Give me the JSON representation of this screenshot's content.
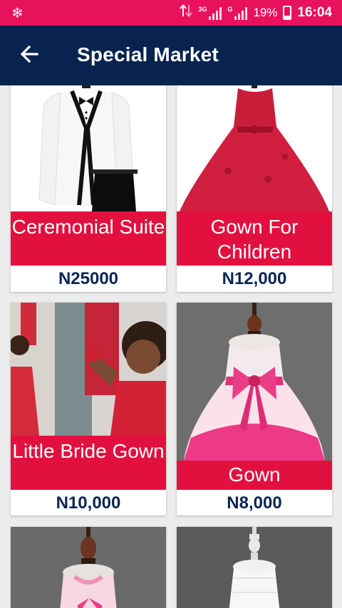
{
  "status_bar": {
    "network_1": "3G",
    "network_2": "G",
    "battery": "19%",
    "time": "16:04"
  },
  "app_bar": {
    "title": "Special Market"
  },
  "products": [
    {
      "name": "Ceremonial Suite",
      "price": "N25000"
    },
    {
      "name": "Gown For Children",
      "price": "N12,000"
    },
    {
      "name": "Little Bride Gown",
      "price": "N10,000"
    },
    {
      "name": "Gown",
      "price": "N8,000"
    }
  ],
  "colors": {
    "status_bar": "#e8115c",
    "app_bar": "#08234f",
    "label_bg": "#e2103f",
    "price_text": "#0b2552"
  }
}
